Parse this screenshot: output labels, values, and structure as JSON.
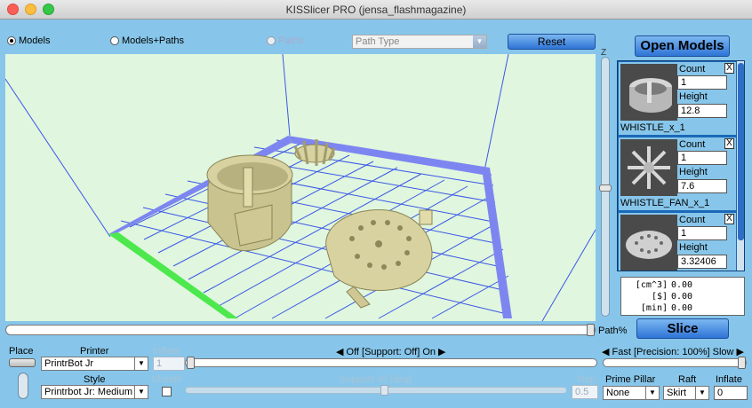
{
  "window": {
    "title": "KISSlicer PRO (jensa_flashmagazine)"
  },
  "view_modes": [
    {
      "label": "Models",
      "selected": true,
      "enabled": true
    },
    {
      "label": "Models+Paths",
      "selected": false,
      "enabled": true
    },
    {
      "label": "Paths",
      "selected": false,
      "enabled": false
    }
  ],
  "path_type": {
    "value": "Path Type"
  },
  "reset_label": "Reset",
  "z_label": "Z",
  "open_models_label": "Open Models",
  "models": [
    {
      "name": "WHISTLE_x_1",
      "count_label": "Count",
      "count": "1",
      "height_label": "Height",
      "height": "12.8",
      "remove": "X"
    },
    {
      "name": "WHISTLE_FAN_x_1",
      "count_label": "Count",
      "count": "1",
      "height_label": "Height",
      "height": "7.6",
      "remove": "X"
    },
    {
      "name": "",
      "count_label": "Count",
      "count": "1",
      "height_label": "Height",
      "height": "3.32406",
      "remove": "X"
    }
  ],
  "stats": [
    {
      "unit": "[cm^3]",
      "value": "0.00"
    },
    {
      "unit": "[$]",
      "value": "0.00"
    },
    {
      "unit": "[min]",
      "value": "0.00"
    }
  ],
  "path_percent_label": "Path%",
  "slice_label": "Slice",
  "bottom": {
    "place_label": "Place",
    "printer_label": "Printer",
    "printer_value": "PrintrBot Jr",
    "style_label": "Style",
    "style_value": "Printrbot Jr: Medium",
    "inflate_label_top": "Inflate",
    "inflate_value_top": "1",
    "sheath_label": "Sheath",
    "support_toggle": "Off [Support: Off] On",
    "support_angle_label": "Support 45 [deg]",
    "gap_label": "Gap",
    "gap_value": "0.5",
    "precision_label": "Fast [Precision: 100%] Slow",
    "prime_pillar_label": "Prime Pillar",
    "prime_pillar_value": "None",
    "raft_label": "Raft",
    "raft_value": "Skirt",
    "inflate_label": "Inflate",
    "inflate_value": "0"
  },
  "colors": {
    "background": "#87c6ea",
    "viewport": "#e0f6de",
    "grid": "#3a57e8",
    "platform_edge": "#7d86f0",
    "x_axis": "#4de84d",
    "model": "#d8d2a0",
    "accent_button": "#2f74d6"
  }
}
